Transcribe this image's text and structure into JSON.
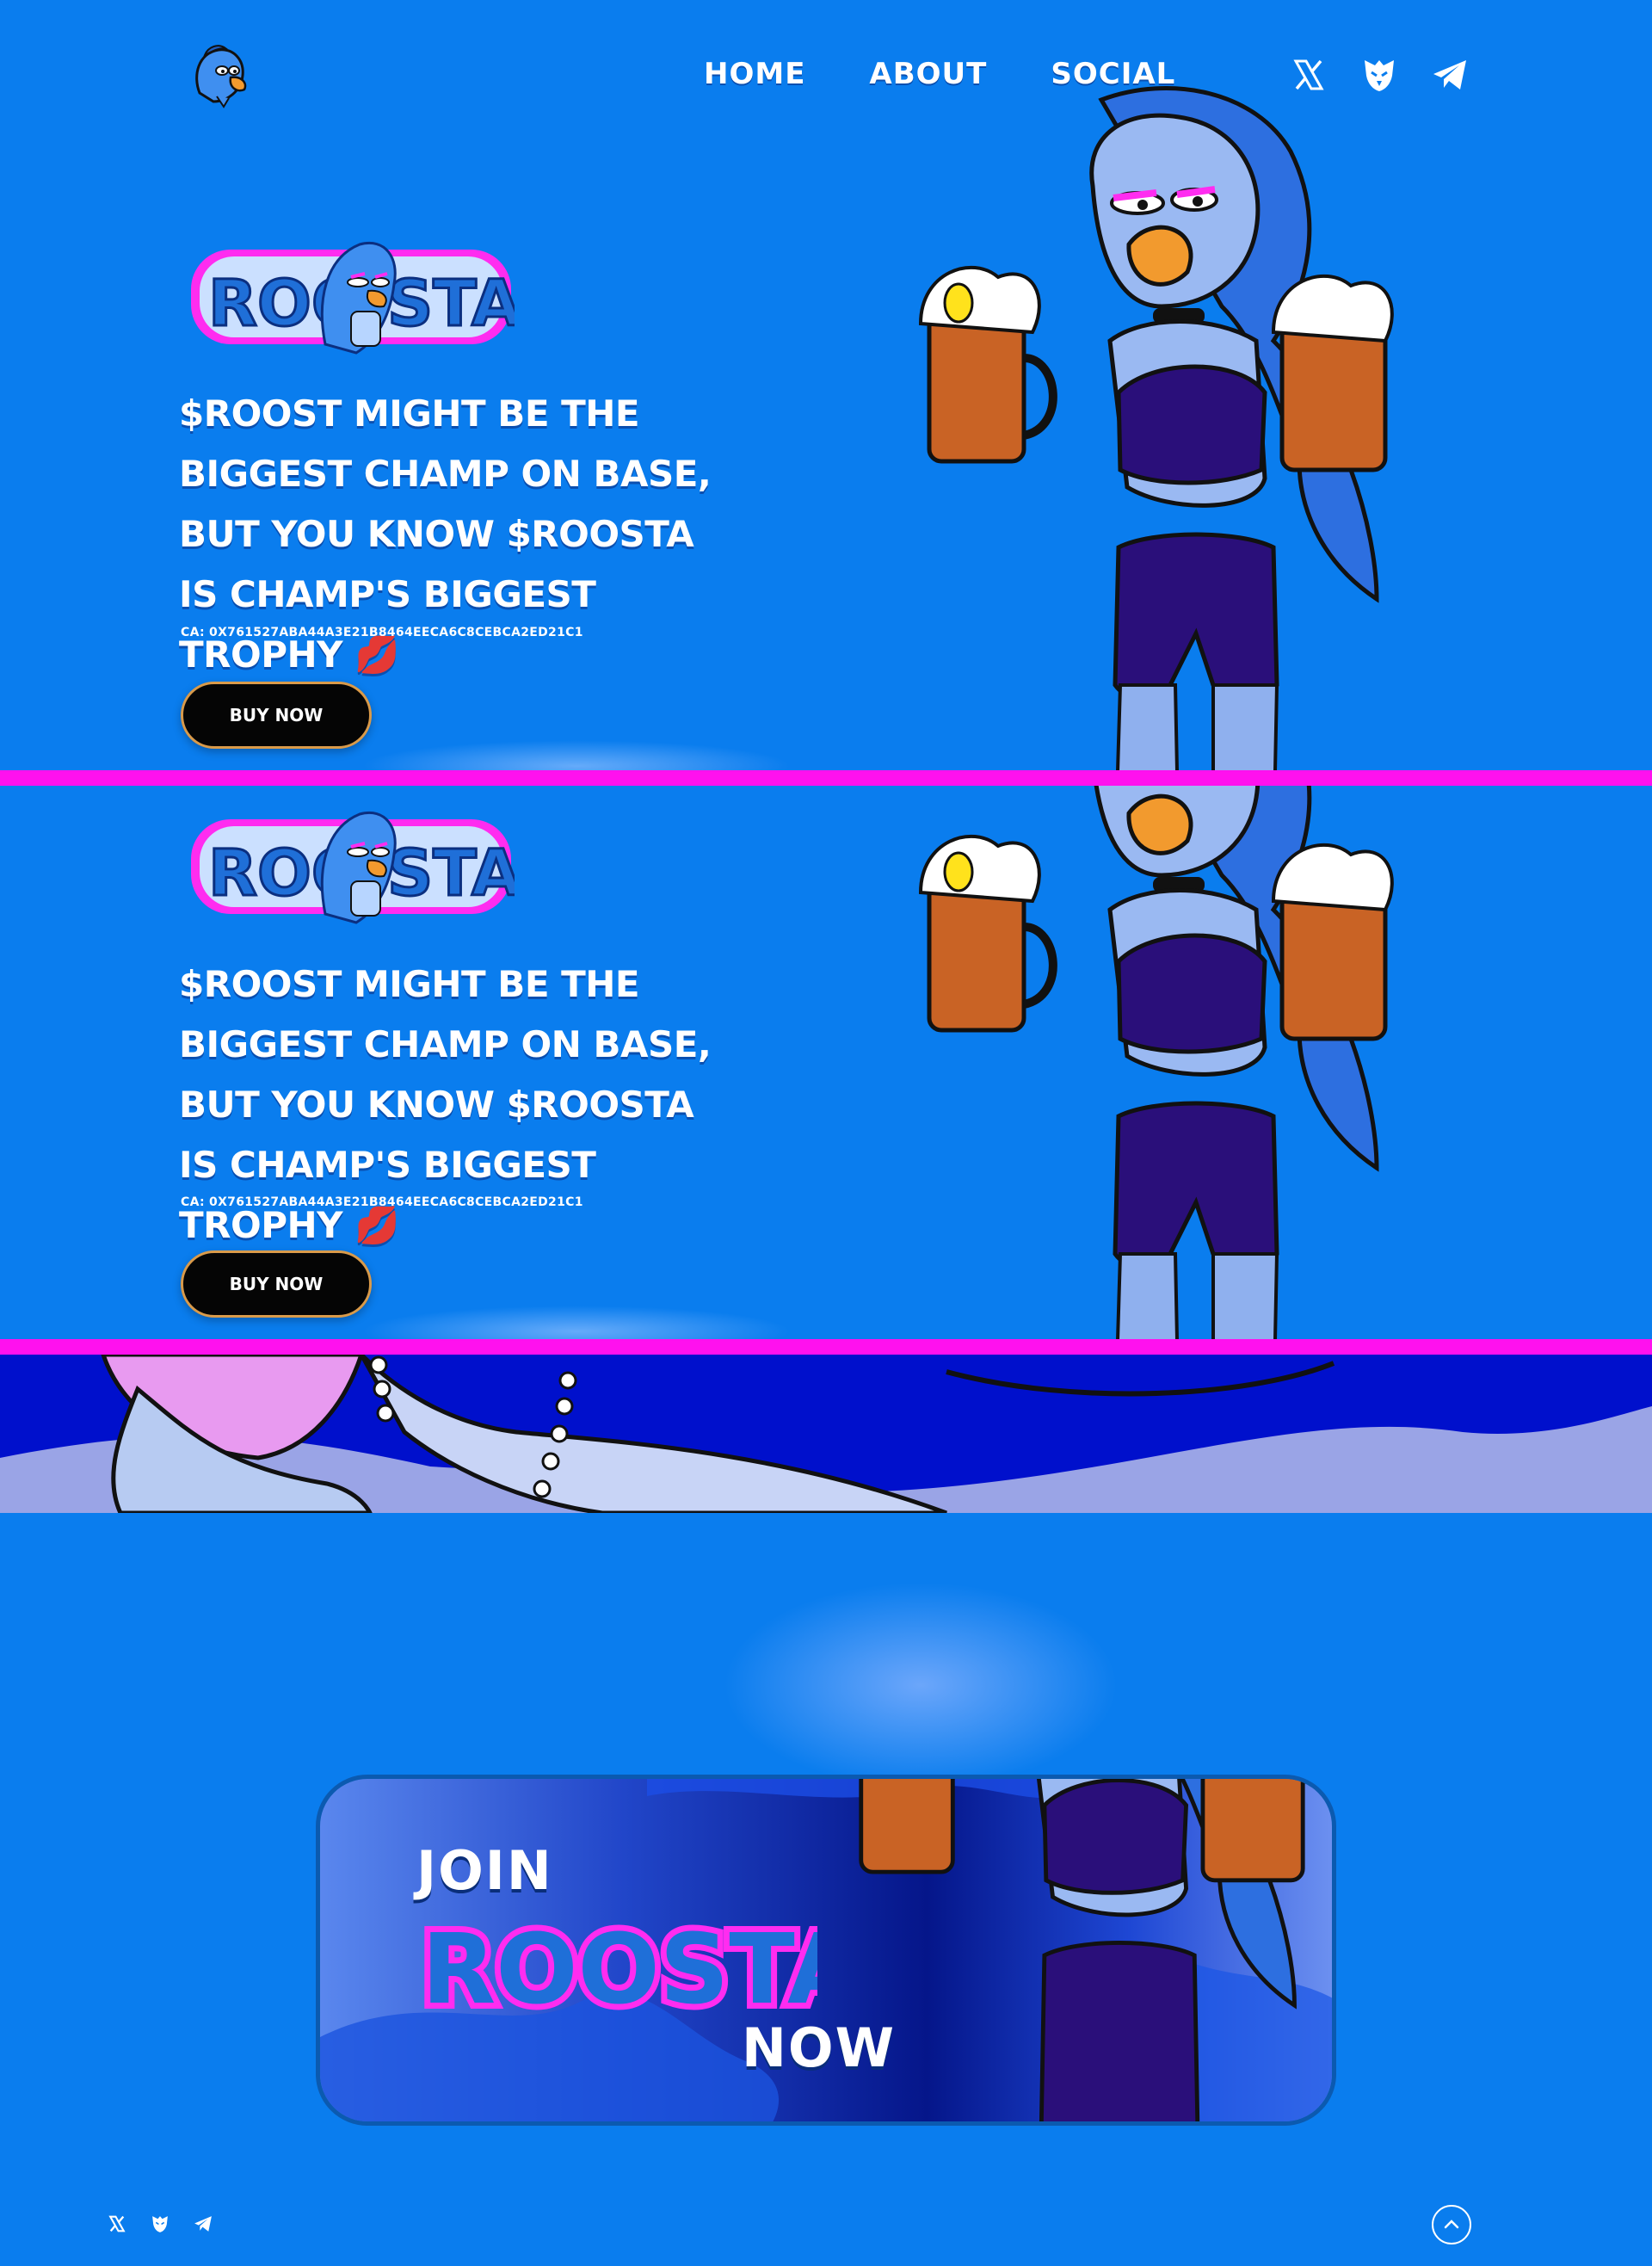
{
  "nav": {
    "logo_icon": "rooster-head-logo",
    "links": [
      {
        "label": "HOME"
      },
      {
        "label": "ABOUT"
      },
      {
        "label": "SOCIAL"
      }
    ],
    "social_icons": [
      "x-icon",
      "eagle-icon",
      "telegram-icon"
    ]
  },
  "hero": {
    "logo_text": "ROOSTA",
    "tagline": "$ROOST MIGHT BE THE BIGGEST CHAMP ON BASE, BUT YOU KNOW $ROOSTA IS CHAMP'S BIGGEST TROPHY 💋",
    "contract": "CA: 0X761527ABA44A3E21B8464EECA6C8CEBCA2ED21C1",
    "buy_label": "BUY NOW"
  },
  "join": {
    "word_join": "JOIN",
    "word_brand": "ROOSTA",
    "word_now": "NOW"
  },
  "footer": {
    "social_icons": [
      "x-icon",
      "eagle-icon",
      "telegram-icon"
    ],
    "to_top_icon": "chevron-up-icon"
  },
  "colors": {
    "background": "#0a7dee",
    "band": "#ff11ee",
    "button": "#050505",
    "button_border": "#d99a4a"
  }
}
